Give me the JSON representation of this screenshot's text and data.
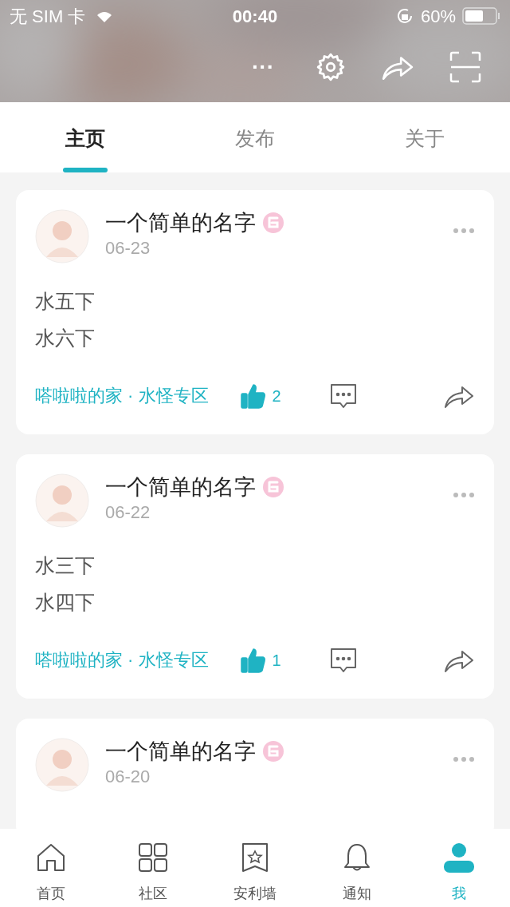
{
  "status_bar": {
    "carrier": "无 SIM 卡",
    "time": "00:40",
    "battery": "60%"
  },
  "header": {
    "more": "···"
  },
  "tabs": [
    {
      "label": "主页",
      "selected": true
    },
    {
      "label": "发布",
      "selected": false
    },
    {
      "label": "关于",
      "selected": false
    }
  ],
  "posts": [
    {
      "author": "一个简单的名字",
      "date": "06-23",
      "lines": [
        "水五下",
        "水六下"
      ],
      "tags": "嗒啦啦的家 · 水怪专区",
      "likes": "2",
      "liked": true
    },
    {
      "author": "一个简单的名字",
      "date": "06-22",
      "lines": [
        "水三下",
        "水四下"
      ],
      "tags": "嗒啦啦的家 · 水怪专区",
      "likes": "1",
      "liked": true
    },
    {
      "author": "一个简单的名字",
      "date": "06-20"
    }
  ],
  "nav": [
    {
      "label": "首页",
      "kind": "home",
      "selected": false
    },
    {
      "label": "社区",
      "kind": "grid",
      "selected": false
    },
    {
      "label": "安利墙",
      "kind": "bookmark",
      "selected": false
    },
    {
      "label": "通知",
      "kind": "bell",
      "selected": false
    },
    {
      "label": "我",
      "kind": "user",
      "selected": true
    }
  ]
}
